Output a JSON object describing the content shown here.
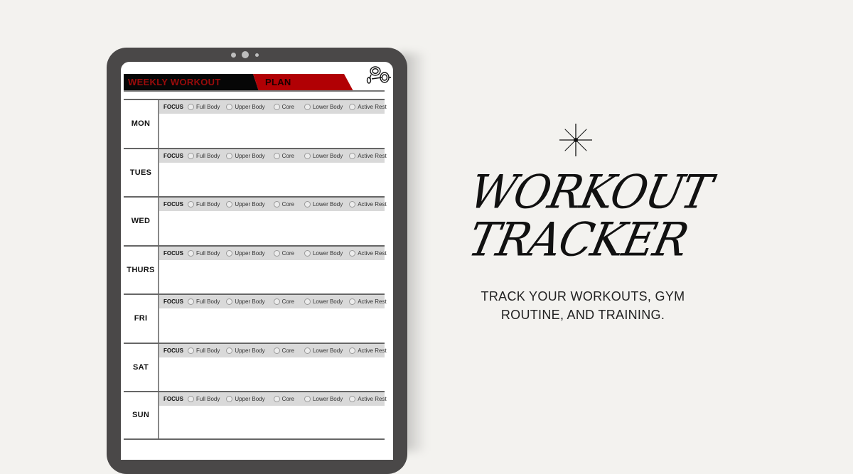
{
  "planner": {
    "header_title_part1": "WEEKLY WORKOUT",
    "header_title_part2": "PLAN",
    "focus_label": "FOCUS",
    "focus_options": [
      "Full Body",
      "Upper Body",
      "Core",
      "Lower Body",
      "Active Rest"
    ],
    "days": [
      {
        "label": "MON"
      },
      {
        "label": "TUES"
      },
      {
        "label": "WED"
      },
      {
        "label": "THURS"
      },
      {
        "label": "FRI"
      },
      {
        "label": "SAT"
      },
      {
        "label": "SUN"
      }
    ],
    "icon": "dumbbell-icon"
  },
  "promo": {
    "decor_icon": "sparkle-star-icon",
    "title_line1": "WORKOUT",
    "title_line2": "TRACKER",
    "subtitle_line1": "TRACK YOUR WORKOUTS, GYM",
    "subtitle_line2": "ROUTINE, AND TRAINING."
  },
  "colors": {
    "background": "#f3f2ef",
    "tablet_frame": "#4a4848",
    "header_red": "#b10004",
    "header_black": "#060606",
    "focus_bar": "#d9d9d9"
  }
}
